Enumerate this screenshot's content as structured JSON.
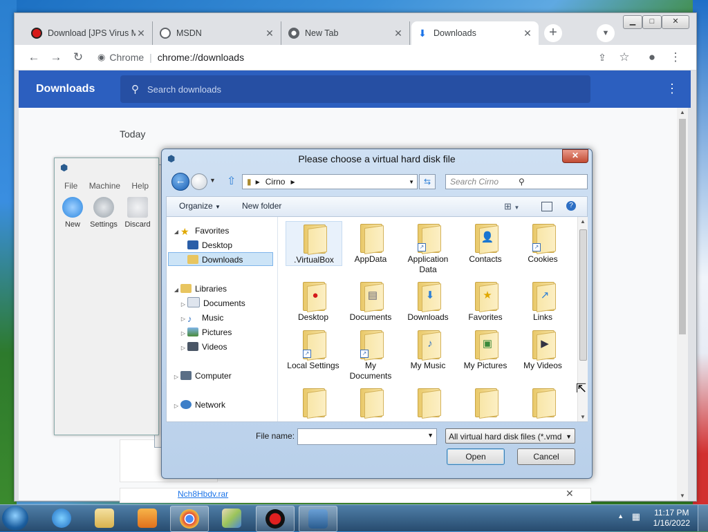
{
  "browser": {
    "tabs": [
      {
        "label": "Download [JPS Virus M",
        "icon": "red-circle-icon"
      },
      {
        "label": "MSDN",
        "icon": "globe-icon"
      },
      {
        "label": "New Tab",
        "icon": "chrome-icon"
      },
      {
        "label": "Downloads",
        "icon": "download-arrow-icon",
        "active": true
      }
    ],
    "omnibox": {
      "chip": "Chrome",
      "url": "chrome://downloads"
    },
    "page": {
      "title": "Downloads",
      "search_placeholder": "Search downloads",
      "section": "Today",
      "file_link": "Nch8Hbdv.rar"
    }
  },
  "vbox_manager": {
    "menu": [
      "File",
      "Machine",
      "Help"
    ],
    "toolbar": [
      {
        "label": "New",
        "color": "#2a86e0"
      },
      {
        "label": "Settings",
        "color": "#9aa3ab"
      },
      {
        "label": "Discard",
        "color": "#c9ccd1"
      }
    ]
  },
  "dialog": {
    "title": "Please choose a virtual hard disk file",
    "address": [
      "Cirno"
    ],
    "search_placeholder": "Search Cirno",
    "commands": {
      "organize": "Organize",
      "new_folder": "New folder"
    },
    "nav": {
      "favorites": "Favorites",
      "favorites_items": [
        "Desktop",
        "Downloads"
      ],
      "libraries": "Libraries",
      "library_items": [
        "Documents",
        "Music",
        "Pictures",
        "Videos"
      ],
      "computer": "Computer",
      "network": "Network"
    },
    "files": [
      {
        "name": ".VirtualBox",
        "overlay": ""
      },
      {
        "name": "AppData",
        "overlay": ""
      },
      {
        "name": "Application Data",
        "overlay": "shortcut"
      },
      {
        "name": "Contacts",
        "overlay": "contacts"
      },
      {
        "name": "Cookies",
        "overlay": "shortcut"
      },
      {
        "name": "Desktop",
        "overlay": "red"
      },
      {
        "name": "Documents",
        "overlay": "doc"
      },
      {
        "name": "Downloads",
        "overlay": "down"
      },
      {
        "name": "Favorites",
        "overlay": "star"
      },
      {
        "name": "Links",
        "overlay": "link"
      },
      {
        "name": "Local Settings",
        "overlay": "shortcut"
      },
      {
        "name": "My Documents",
        "overlay": "shortcut"
      },
      {
        "name": "My Music",
        "overlay": "music"
      },
      {
        "name": "My Pictures",
        "overlay": "pic"
      },
      {
        "name": "My Videos",
        "overlay": "vid"
      }
    ],
    "file_name_label": "File name:",
    "file_name_value": "",
    "file_type": "All virtual hard disk files (*.vmd",
    "open_label": "Open",
    "cancel_label": "Cancel"
  },
  "taskbar": {
    "clock_time": "11:17 PM",
    "clock_date": "1/16/2022"
  },
  "colors": {
    "chrome_accent": "#2c5fbf",
    "dialog_frame": "#b9d0ea"
  }
}
